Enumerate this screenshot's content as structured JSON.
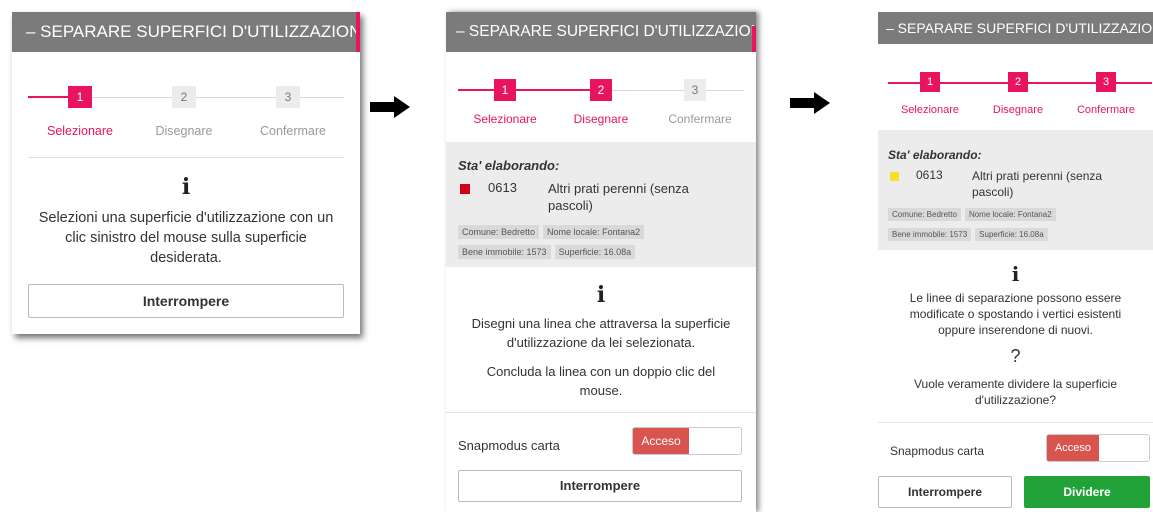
{
  "panel1": {
    "title": "– SEPARARE SUPERFICI D'UTILIZZAZIONE",
    "steps": [
      {
        "num": "1",
        "label": "Selezionare",
        "active": true
      },
      {
        "num": "2",
        "label": "Disegnare",
        "active": false
      },
      {
        "num": "3",
        "label": "Confermare",
        "active": false
      }
    ],
    "info_icon": "i",
    "message": "Selezioni una superficie d'utilizzazione con un clic sinistro del mouse sulla superficie desiderata.",
    "cancel_label": "Interrompere"
  },
  "panel2": {
    "title": "– SEPARARE SUPERFICI D'UTILIZZAZIONE",
    "steps": [
      {
        "num": "1",
        "label": "Selezionare",
        "active": true
      },
      {
        "num": "2",
        "label": "Disegnare",
        "active": true
      },
      {
        "num": "3",
        "label": "Confermare",
        "active": false
      }
    ],
    "processing_label": "Sta' elaborando:",
    "item_code": "0613",
    "item_desc": "Altri prati perenni (senza pascoli)",
    "item_color": "#d0021b",
    "tags": [
      "Comune: Bedretto",
      "Nome locale: Fontana2",
      "Bene immobile: 1573",
      "Superficie: 16.08a"
    ],
    "info_icon": "i",
    "message1": "Disegni una linea che attraversa la superficie d'utilizzazione da lei selezionata.",
    "message2": "Concluda la linea con un doppio clic del mouse.",
    "snap_label": "Snapmodus carta",
    "snap_state": "Acceso",
    "cancel_label": "Interrompere"
  },
  "panel3": {
    "title": "– SEPARARE SUPERFICI D'UTILIZZAZIONE",
    "steps": [
      {
        "num": "1",
        "label": "Selezionare",
        "active": true
      },
      {
        "num": "2",
        "label": "Disegnare",
        "active": true
      },
      {
        "num": "3",
        "label": "Confermare",
        "active": true
      }
    ],
    "processing_label": "Sta' elaborando:",
    "item_code": "0613",
    "item_desc": "Altri prati perenni (senza pascoli)",
    "item_color": "#f5e12a",
    "tags": [
      "Comune: Bedretto",
      "Nome locale: Fontana2",
      "Bene immobile: 1573",
      "Superficie: 16.08a"
    ],
    "info_icon": "i",
    "message": "Le linee di separazione possono essere modificate o spostando i vertici esistenti oppure inserendone di nuovi.",
    "question_icon": "?",
    "question": "Vuole veramente dividere la superficie d'utilizzazione?",
    "snap_label": "Snapmodus carta",
    "snap_state": "Acceso",
    "cancel_label": "Interrompere",
    "confirm_label": "Dividere"
  },
  "colors": {
    "accent": "#e8145f",
    "titlebar": "#7b7b7b",
    "confirm": "#22a33a",
    "toggle_on": "#d9534f"
  }
}
